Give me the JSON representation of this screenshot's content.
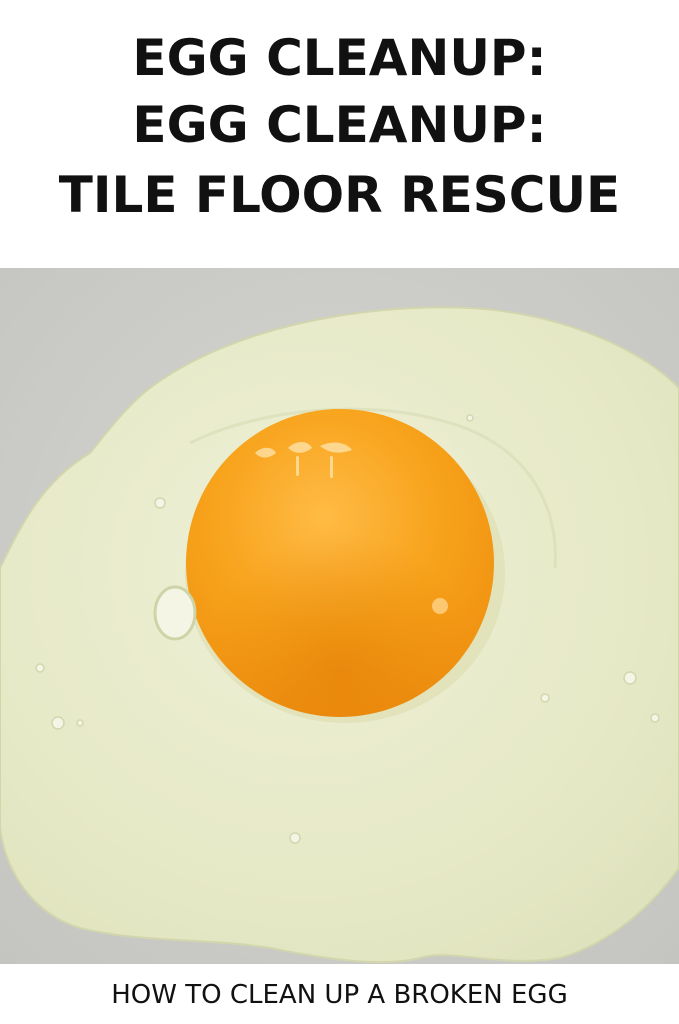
{
  "header": {
    "title_lines": [
      "EGG CLEANUP:",
      "EGG CLEANUP:",
      "TILE FLOOR RESCUE"
    ]
  },
  "photo": {
    "subject": "broken-egg-on-tile-floor",
    "colors": {
      "floor": "#cfcfcb",
      "white": "#e9eccb",
      "yolk": "#f7a21a",
      "yolk_center": "#ffb43a"
    }
  },
  "footer": {
    "caption": "HOW TO CLEAN UP A BROKEN EGG"
  }
}
